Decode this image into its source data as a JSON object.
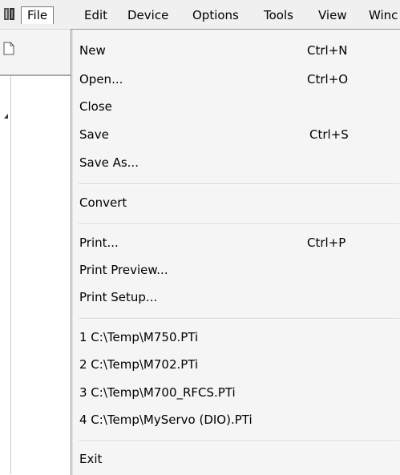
{
  "menubar": {
    "items": [
      {
        "label": "File",
        "active": true
      },
      {
        "label": "Edit"
      },
      {
        "label": "Device"
      },
      {
        "label": "Options"
      },
      {
        "label": "Tools"
      },
      {
        "label": "View"
      },
      {
        "label": "Winc"
      }
    ]
  },
  "file_menu": {
    "new": {
      "label": "New",
      "shortcut": "Ctrl+N"
    },
    "open": {
      "label": "Open...",
      "shortcut": "Ctrl+O"
    },
    "close": {
      "label": "Close"
    },
    "save": {
      "label": "Save",
      "shortcut": "Ctrl+S"
    },
    "save_as": {
      "label": "Save As..."
    },
    "convert": {
      "label": "Convert"
    },
    "print": {
      "label": "Print...",
      "shortcut": "Ctrl+P"
    },
    "print_preview": {
      "label": "Print Preview..."
    },
    "print_setup": {
      "label": "Print Setup..."
    },
    "recent": [
      {
        "label": "1 C:\\Temp\\M750.PTi"
      },
      {
        "label": "2 C:\\Temp\\M702.PTi"
      },
      {
        "label": "3 C:\\Temp\\M700_RFCS.PTi"
      },
      {
        "label": "4 C:\\Temp\\MyServo (DIO).PTi"
      }
    ],
    "exit": {
      "label": "Exit"
    }
  },
  "icons": [
    "app-book-icon",
    "new-document-icon",
    "tree-expander-icon"
  ],
  "colors": {
    "menu_bg": "#f5f5f5",
    "menubar_bg": "#f0f0f0",
    "border": "#979797"
  }
}
